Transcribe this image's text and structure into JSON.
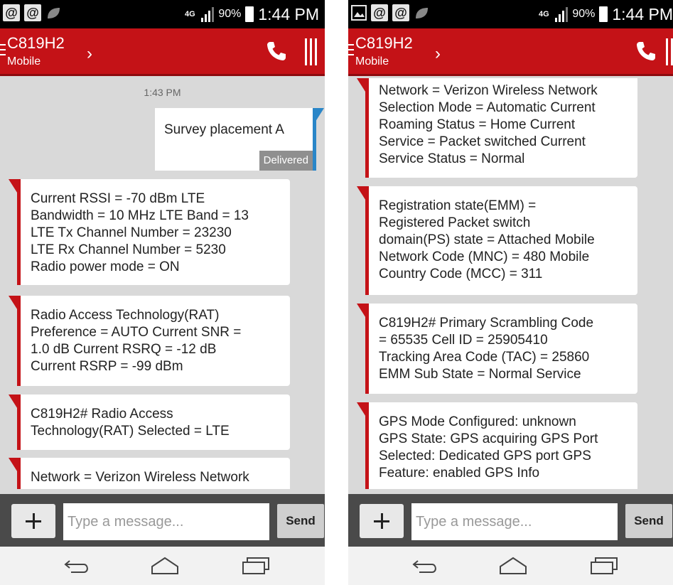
{
  "status_bar": {
    "left_icons": [
      "@",
      "@"
    ],
    "network": "4G",
    "battery": "90%",
    "time": "1:44 PM"
  },
  "app_bar": {
    "contact_name": "C819H2",
    "contact_sub": "Mobile",
    "chevron": "›"
  },
  "compose": {
    "placeholder": "Type a message...",
    "send_label": "Send",
    "attach_icon": "plus-icon"
  },
  "left": {
    "timestamp": "1:43 PM",
    "outgoing": {
      "text": "Survey placement A",
      "status": "Delivered"
    },
    "messages": [
      [
        "Current RSSI = -70 dBm LTE",
        "Bandwidth = 10 MHz LTE Band =  13",
        "LTE Tx Channel Number =  23230",
        "LTE Rx Channel Number =  5230",
        "Radio power mode = ON"
      ],
      [
        "Radio Access Technology(RAT)",
        "Preference = AUTO Current SNR =",
        "1.0  dB Current RSRQ = -12  dB",
        "Current RSRP = -99  dBm"
      ],
      [
        "C819H2# Radio Access",
        "Technology(RAT) Selected = LTE"
      ],
      [
        "Network = Verizon Wireless Network"
      ]
    ]
  },
  "right": {
    "messages": [
      [
        "Network = Verizon Wireless Network",
        "Selection Mode = Automatic Current",
        "Roaming Status = Home Current",
        "Service = Packet switched Current",
        "Service Status = Normal"
      ],
      [
        "Registration state(EMM) =",
        "Registered Packet switch",
        "domain(PS) state = Attached Mobile",
        "Network Code (MNC) = 480 Mobile",
        "Country Code (MCC) = 311"
      ],
      [
        "C819H2# Primary Scrambling Code",
        "= 65535 Cell ID = 25905410",
        "Tracking Area Code (TAC) = 25860",
        "EMM Sub State = Normal Service"
      ],
      [
        "GPS Mode Configured: unknown",
        "GPS State: GPS acquiring GPS Port",
        "Selected: Dedicated GPS port GPS",
        "Feature: enabled GPS Info"
      ]
    ]
  },
  "colors": {
    "app_bar": "#c41217",
    "outgoing_accent": "#2a86c8",
    "background": "#d9d9d9"
  }
}
